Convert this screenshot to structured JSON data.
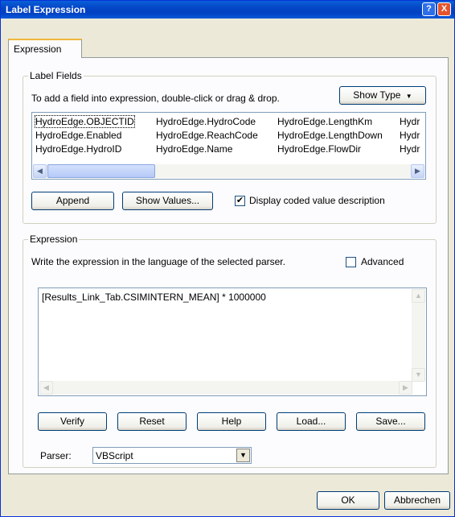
{
  "window": {
    "title": "Label Expression",
    "help_glyph": "?",
    "close_glyph": "X"
  },
  "tab": {
    "label": "Expression"
  },
  "label_fields": {
    "legend": "Label Fields",
    "instruction": "To add a field into expression, double-click or drag & drop.",
    "show_type_button": "Show Type",
    "rows": [
      [
        "HydroEdge.OBJECTID",
        "HydroEdge.HydroCode",
        "HydroEdge.LengthKm",
        "Hydr"
      ],
      [
        "HydroEdge.Enabled",
        "HydroEdge.ReachCode",
        "HydroEdge.LengthDown",
        "Hydr"
      ],
      [
        "HydroEdge.HydroID",
        "HydroEdge.Name",
        "HydroEdge.FlowDir",
        "Hydr"
      ]
    ],
    "append_button": "Append",
    "show_values_button": "Show Values...",
    "display_coded_label": "Display coded value description",
    "display_coded_checked": true
  },
  "expression": {
    "legend": "Expression",
    "instruction": "Write the expression in the language of the selected parser.",
    "advanced_label": "Advanced",
    "advanced_checked": false,
    "text": "[Results_Link_Tab.CSIMINTERN_MEAN] * 1000000",
    "verify_button": "Verify",
    "reset_button": "Reset",
    "help_button": "Help",
    "load_button": "Load...",
    "save_button": "Save...",
    "parser_label": "Parser:",
    "parser_value": "VBScript"
  },
  "footer": {
    "ok_button": "OK",
    "cancel_button": "Abbrechen"
  }
}
